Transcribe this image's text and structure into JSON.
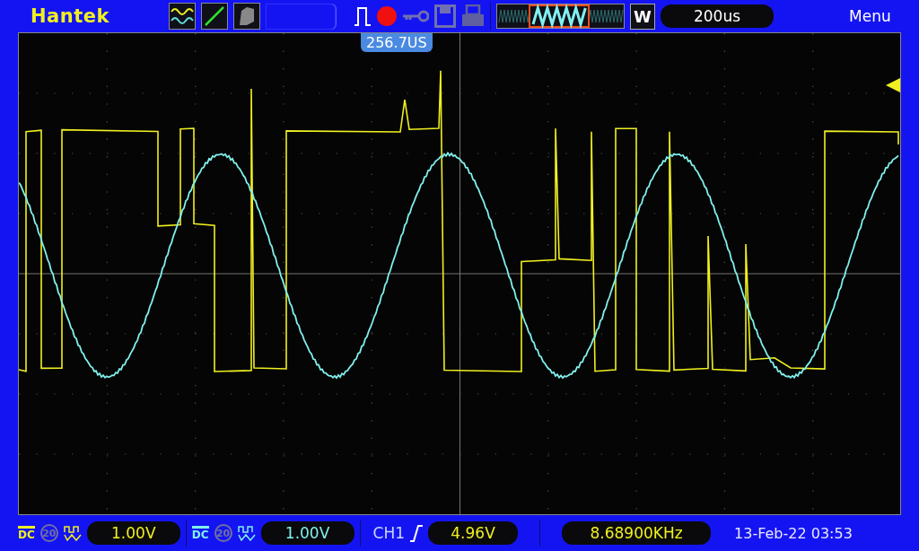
{
  "brand": "Hantek",
  "top_bar": {
    "window_key": "W",
    "timebase": "200us",
    "menu": "Menu"
  },
  "trigger_position": "256.7US",
  "channels": [
    {
      "coupling": "DC",
      "bandwidth": "20",
      "scale": "1.00V",
      "color": "#f0f020"
    },
    {
      "coupling": "DC",
      "bandwidth": "20",
      "scale": "1.00V",
      "color": "#80f0ec"
    }
  ],
  "trigger": {
    "source": "CH1",
    "level": "4.96V"
  },
  "frequency": "8.68900KHz",
  "datetime": "13-Feb-22 03:53"
}
